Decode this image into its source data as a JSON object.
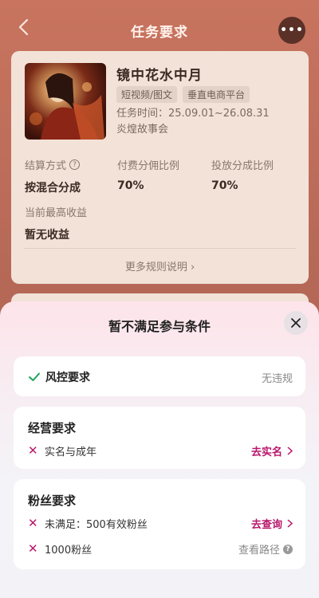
{
  "nav": {
    "title": "任务要求",
    "more_label": "•••"
  },
  "task": {
    "name": "镜中花水中月",
    "tags": [
      "短视频/图文",
      "垂直电商平台"
    ],
    "time": "任务时间：25.09.01~26.08.31",
    "org": "炎煌故事会",
    "metrics": {
      "settlement_label": "结算方式",
      "settlement_value": "按混合分成",
      "paid_label": "付费分佣比例",
      "paid_value": "70%",
      "ad_label": "投放分成比例",
      "ad_value": "70%",
      "income_label": "当前最高收益",
      "income_value": "暂无收益"
    },
    "more_rules": "更多规则说明 ›"
  },
  "sheet": {
    "title": "暂不满足参与条件",
    "risk": {
      "title": "风控要求",
      "status": "无违规"
    },
    "business": {
      "title": "经营要求",
      "items": [
        {
          "text": "实名与成年",
          "action": "去实名"
        }
      ]
    },
    "fans": {
      "title": "粉丝要求",
      "items": [
        {
          "text": "未满足：500有效粉丝",
          "action": "去查询"
        },
        {
          "text": "1000粉丝",
          "action": "查看路径"
        }
      ]
    }
  },
  "colors": {
    "accent": "#b8176c",
    "check": "#1aa35f"
  }
}
